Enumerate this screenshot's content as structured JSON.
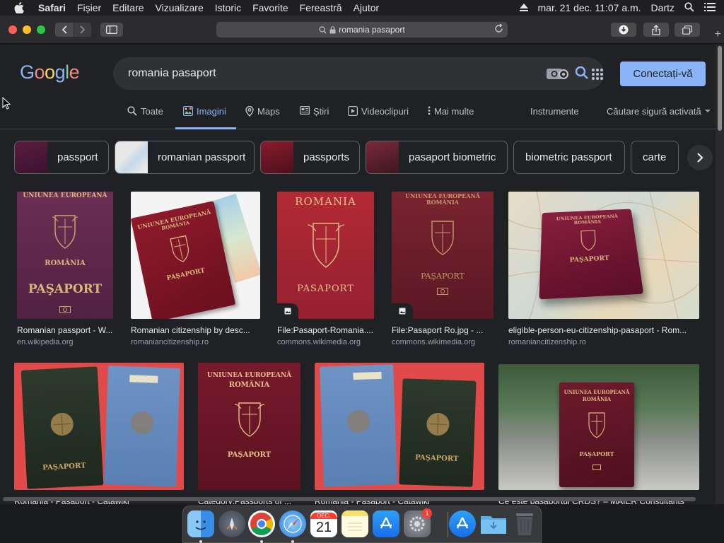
{
  "menubar": {
    "app": "Safari",
    "items": [
      "Fișier",
      "Editare",
      "Vizualizare",
      "Istoric",
      "Favorite",
      "Fereastră",
      "Ajutor"
    ],
    "clock": "mar. 21 dec.  11:07 a.m.",
    "user": "Dartz"
  },
  "browser": {
    "address": "romania pasaport"
  },
  "google": {
    "logo_letters": [
      "G",
      "o",
      "o",
      "g",
      "l",
      "e"
    ],
    "query": "romania pasaport",
    "sign_in": "Conectați-vă",
    "tabs": {
      "all": "Toate",
      "images": "Imagini",
      "maps": "Maps",
      "news": "Știri",
      "videos": "Videoclipuri",
      "more": "Mai multe",
      "tools": "Instrumente",
      "safe_search": "Căutare sigură activată"
    },
    "chips": [
      "passport",
      "romanian passport",
      "passports",
      "pasaport biometric",
      "biometric passport",
      "carte"
    ],
    "results": [
      {
        "title": "Romanian passport - W...",
        "source": "en.wikipedia.org"
      },
      {
        "title": "Romanian citizenship by desc...",
        "source": "romaniancitizenship.ro"
      },
      {
        "title": "File:Pasaport-Romania....",
        "source": "commons.wikimedia.org"
      },
      {
        "title": "File:Pasaport Ro.jpg - ...",
        "source": "commons.wikimedia.org"
      },
      {
        "title": "eligible-person-eu-citizenship-pasaport - Rom...",
        "source": "romaniancitizenship.ro"
      },
      {
        "title": "Romania - Pasaport - Catawiki",
        "source": ""
      },
      {
        "title": "Category:Passports of ...",
        "source": ""
      },
      {
        "title": "Romania - Pasaport - Catawiki",
        "source": ""
      },
      {
        "title": "Ce este pașaportul CRDS? – MAIER Consultants",
        "source": ""
      }
    ],
    "passport_text": {
      "eu": "UNIUNEA EUROPEANĂ",
      "country_upper": "ROMÂNIA",
      "country_plain": "ROMANIA",
      "doc": "PAŞAPORT",
      "doc_plain": "PASAPORT"
    }
  },
  "dock": {
    "calendar_month": "DEC.",
    "calendar_day": "21",
    "badge": "1"
  },
  "colors": {
    "page_bg": "#202124",
    "accent": "#8ab4f8",
    "passport_burgundy": "#6e1a2e",
    "passport_red": "#a52a3a"
  }
}
